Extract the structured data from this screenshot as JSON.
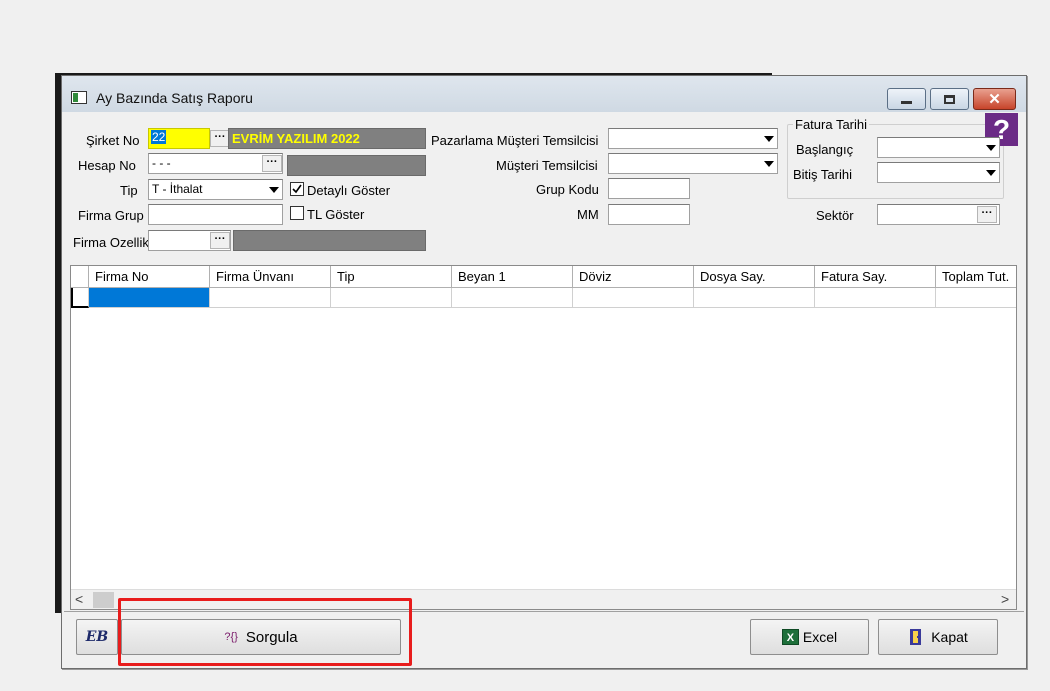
{
  "window": {
    "title": "Ay Bazında Satış Raporu",
    "close_glyph": "✕"
  },
  "form": {
    "sirket_no_label": "Şirket No",
    "sirket_no_value": "22",
    "sirket_name": "EVRİM YAZILIM  2022",
    "hesap_no_label": "Hesap No",
    "hesap_no_value": " - - -",
    "tip_label": "Tip",
    "tip_value": "T - İthalat",
    "firma_grup_label": "Firma Grup",
    "firma_ozellik_label": "Firma Ozellik",
    "detayli_label": "Detaylı Göster",
    "detayli_checked": true,
    "tl_goster_label": "TL Göster",
    "tl_goster_checked": false,
    "pazarlama_label": "Pazarlama Müşteri Temsilcisi",
    "musteri_temsilcisi_label": "Müşteri Temsilcisi",
    "grup_kodu_label": "Grup Kodu",
    "mm_label": "MM",
    "sektor_label": "Sektör",
    "fatura_tarihi_label": "Fatura Tarihi",
    "baslangic_label": "Başlangıç",
    "bitis_label": "Bitiş Tarihi",
    "dots": "···",
    "help_glyph": "?"
  },
  "grid": {
    "columns": [
      "Firma No",
      "Firma Ünvanı",
      "Tip",
      "Beyan 1",
      "Döviz",
      "Dosya Say.",
      "Fatura Say.",
      "Toplam Tut."
    ],
    "scroll_left": "<",
    "scroll_right": ">"
  },
  "buttons": {
    "logo_text": "EB",
    "sorgula_icon": "?{}",
    "sorgula_label": "Sorgula",
    "excel_label": "Excel",
    "kapat_label": "Kapat"
  },
  "colors": {
    "highlight_yellow": "#ffff00",
    "company_gray": "#808080",
    "company_text": "#ffff00",
    "selection_blue": "#0078d7",
    "annotation_red": "#e81c1c"
  }
}
